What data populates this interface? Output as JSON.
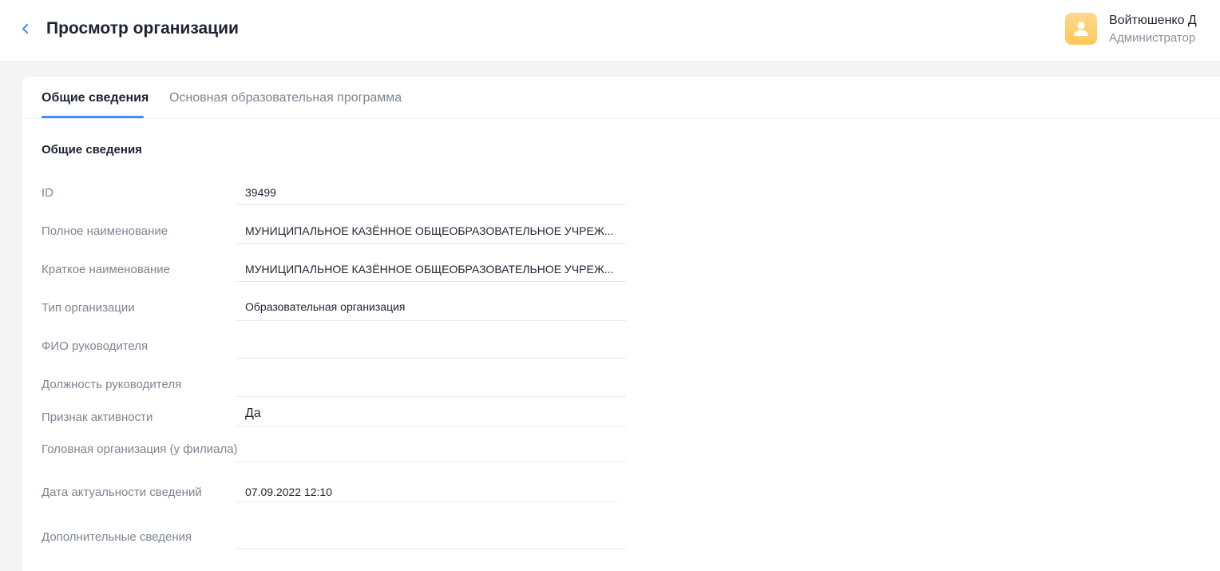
{
  "header": {
    "title": "Просмотр организации",
    "back_icon": "chevron-left-icon",
    "accent_color": "#3d8bfd"
  },
  "user": {
    "name": "Войтюшенко Д",
    "role": "Администратор",
    "avatar_icon": "user-icon",
    "avatar_color": "#ffc85c"
  },
  "tabs": [
    {
      "label": "Общие сведения",
      "active": true
    },
    {
      "label": "Основная образовательная программа",
      "active": false
    }
  ],
  "section": {
    "title": "Общие сведения"
  },
  "fields": [
    {
      "label": "ID",
      "value": "39499"
    },
    {
      "label": "Полное наименование",
      "value": "МУНИЦИПАЛЬНОЕ КАЗЁННОЕ ОБЩЕОБРАЗОВАТЕЛЬНОЕ УЧРЕЖ..."
    },
    {
      "label": "Краткое наименование",
      "value": "МУНИЦИПАЛЬНОЕ КАЗЁННОЕ ОБЩЕОБРАЗОВАТЕЛЬНОЕ УЧРЕЖ..."
    },
    {
      "label": "Тип организации",
      "value": "Образовательная организация"
    },
    {
      "label": "ФИО руководителя",
      "value": ""
    },
    {
      "label": "Должность руководителя",
      "value": ""
    },
    {
      "label": "Признак активности",
      "value": "Да"
    },
    {
      "label": "Головная организация (у филиала)",
      "value": ""
    },
    {
      "label": "Дата актуальности сведений",
      "value": "07.09.2022 12:10"
    },
    {
      "label": "Дополнительные сведения",
      "value": ""
    }
  ]
}
